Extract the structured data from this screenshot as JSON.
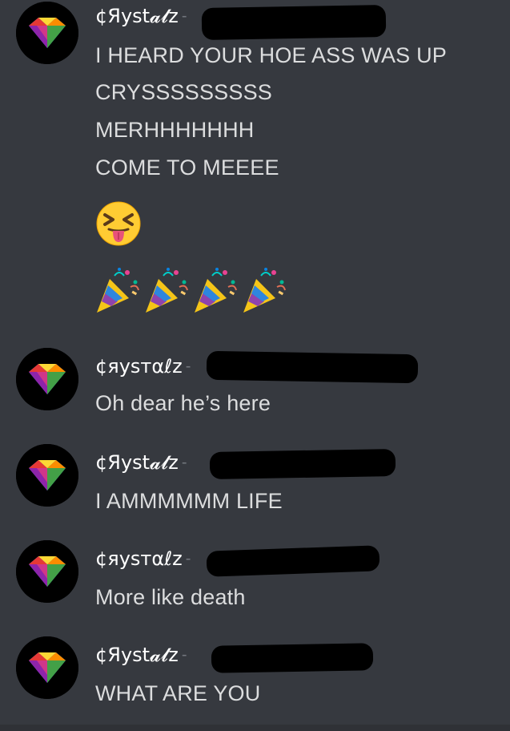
{
  "messages": [
    {
      "username": "¢Яyst𝓪𝓵z",
      "lines": [
        "I HEARD YOUR HOE ASS WAS UP",
        "CRYSSSSSSSSS",
        "MERHHHHHHH",
        "COME TO MEEEE"
      ],
      "emoji": [
        "squinting-face-with-tongue-emoji"
      ],
      "party_poppers": [
        "party-popper-emoji",
        "party-popper-emoji",
        "party-popper-emoji",
        "party-popper-emoji"
      ]
    },
    {
      "username": "¢яysтαℓz",
      "lines": [
        "Oh dear he’s here"
      ]
    },
    {
      "username": "¢Яyst𝓪𝓵z",
      "lines": [
        "I AMMMMMM LIFE"
      ]
    },
    {
      "username": "¢яysтαℓz",
      "lines": [
        "More like death"
      ]
    },
    {
      "username": "¢Яyst𝓪𝓵z",
      "lines": [
        "WHAT ARE YOU"
      ]
    }
  ],
  "colors": {
    "background": "#36393f",
    "username": "#ffffff",
    "message_text": "#dcddde",
    "redaction": "#000000"
  }
}
